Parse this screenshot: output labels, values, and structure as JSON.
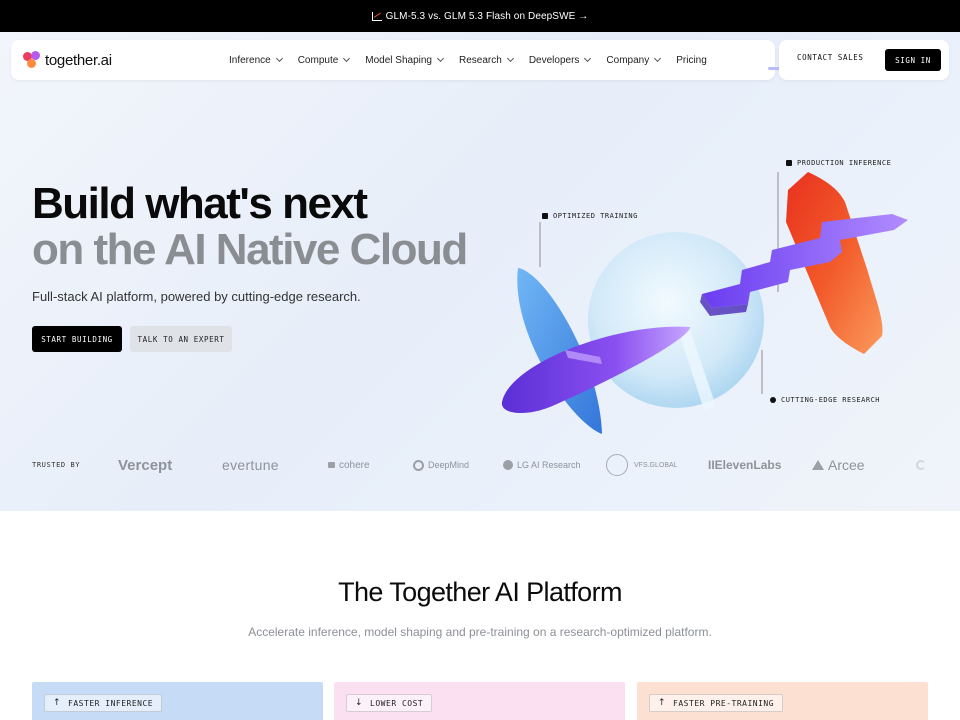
{
  "announcement": {
    "text": "GLM-5.3 vs. GLM 5.3 Flash on DeepSWE →",
    "icon": "chart-icon"
  },
  "nav": {
    "logo_text": "together.ai",
    "items": [
      {
        "label": "Inference",
        "has_dropdown": true
      },
      {
        "label": "Compute",
        "has_dropdown": true
      },
      {
        "label": "Model Shaping",
        "has_dropdown": true
      },
      {
        "label": "Research",
        "has_dropdown": true
      },
      {
        "label": "Developers",
        "has_dropdown": true
      },
      {
        "label": "Company",
        "has_dropdown": true
      },
      {
        "label": "Pricing",
        "has_dropdown": false
      }
    ],
    "contact_sales": "CONTACT SALES",
    "sign_in": "SIGN IN"
  },
  "hero": {
    "headline_line1": "Build what's next",
    "headline_line2": "on the AI Native Cloud",
    "subline": "Full-stack AI platform, powered by cutting-edge research.",
    "primary_cta": "START BUILDING",
    "secondary_cta": "TALK TO AN EXPERT",
    "callouts": {
      "production_inference": "PRODUCTION INFERENCE",
      "optimized_training": "OPTIMIZED TRAINING",
      "cutting_edge_research": "CUTTING-EDGE RESEARCH"
    }
  },
  "trusted": {
    "label": "TRUSTED BY",
    "logos": [
      "Vercept",
      "evertune",
      "cohere",
      "DeepMind",
      "LG AI Research",
      "VFS.GLOBAL",
      "IIElevenLabs",
      "Arcee"
    ]
  },
  "platform": {
    "title": "The Together AI Platform",
    "subtitle": "Accelerate inference, model shaping and pre-training on a research-optimized platform.",
    "cards": [
      {
        "tag": "FASTER INFERENCE",
        "arrow": "↑",
        "color": "#c6dcf6"
      },
      {
        "tag": "LOWER COST",
        "arrow": "↓",
        "color": "#fbe0f1"
      },
      {
        "tag": "FASTER PRE-TRAINING",
        "arrow": "↑",
        "color": "#fce0d2"
      }
    ]
  },
  "colors": {
    "accent_purple": "#7b4bf0",
    "accent_orange": "#f0562a",
    "accent_blue": "#3b82e0"
  }
}
